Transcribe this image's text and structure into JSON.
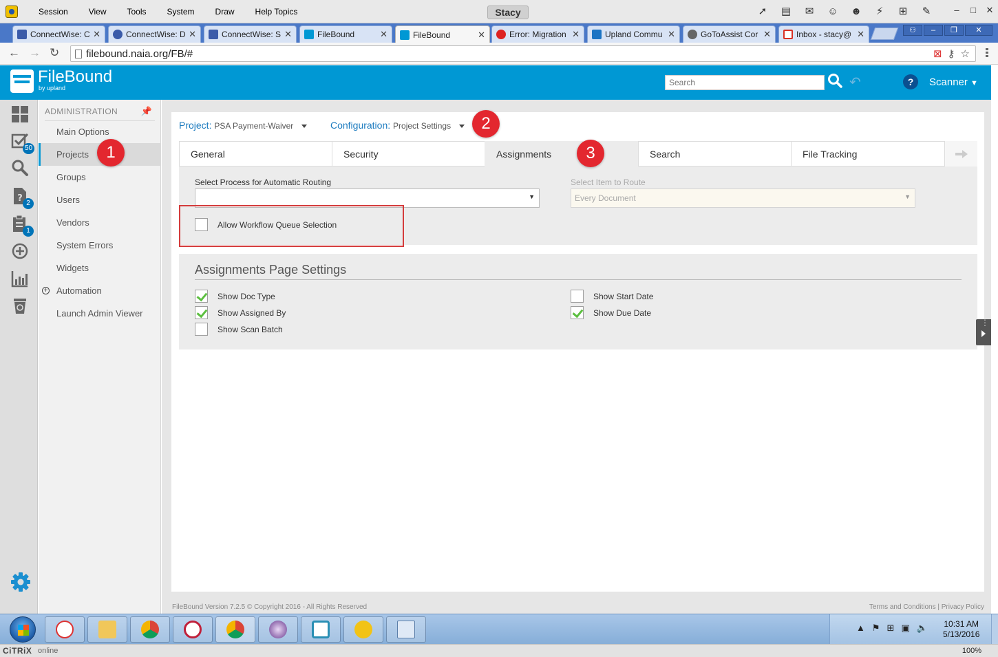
{
  "session": {
    "menu": [
      "Session",
      "View",
      "Tools",
      "System",
      "Draw",
      "Help Topics"
    ],
    "title": "Stacy",
    "tool_icons": [
      "cursor-icon",
      "clipboard-icon",
      "chat-icon",
      "users-icon",
      "user-icon",
      "plug-icon",
      "add-icon",
      "tools-icon"
    ]
  },
  "browser": {
    "tabs": [
      {
        "label": "ConnectWise: C",
        "icon": "connectwise-icon",
        "color": "#3b5ba9",
        "active": false
      },
      {
        "label": "ConnectWise: D",
        "icon": "connectwise-icon",
        "color": "#3b5ba9",
        "active": false
      },
      {
        "label": "ConnectWise: S",
        "icon": "connectwise-icon",
        "color": "#3b5ba9",
        "active": false
      },
      {
        "label": "FileBound",
        "icon": "filebound-icon",
        "color": "#0098d4",
        "active": false
      },
      {
        "label": "FileBound",
        "icon": "filebound-icon",
        "color": "#0098d4",
        "active": true
      },
      {
        "label": "Error: Migration",
        "icon": "error-icon",
        "color": "#d22",
        "active": false
      },
      {
        "label": "Upland Commu",
        "icon": "upland-icon",
        "color": "#1b74c4",
        "active": false
      },
      {
        "label": "GoToAssist Cor",
        "icon": "gotoassist-icon",
        "color": "#666",
        "active": false
      },
      {
        "label": "Inbox - stacy@",
        "icon": "gmail-icon",
        "color": "#d93025",
        "active": false
      }
    ],
    "url": "filebound.naia.org/FB/#"
  },
  "header": {
    "brand": "FileBound",
    "brand_sub": "by upland",
    "search_placeholder": "Search",
    "help": "?",
    "user_menu": "Scanner"
  },
  "rail": {
    "badges": {
      "tasks": "50",
      "help": "2",
      "clipboard": "1"
    }
  },
  "sidebar": {
    "heading": "ADMINISTRATION",
    "items": [
      {
        "label": "Main Options",
        "active": false
      },
      {
        "label": "Projects",
        "active": true
      },
      {
        "label": "Groups",
        "active": false
      },
      {
        "label": "Users",
        "active": false
      },
      {
        "label": "Vendors",
        "active": false
      },
      {
        "label": "System Errors",
        "active": false
      },
      {
        "label": "Widgets",
        "active": false
      },
      {
        "label": "Automation",
        "active": false
      },
      {
        "label": "Launch Admin Viewer",
        "active": false
      }
    ]
  },
  "project": {
    "project_label": "Project:",
    "project_value": "PSA Payment-Waiver",
    "config_label": "Configuration:",
    "config_value": "Project Settings"
  },
  "tabs": [
    "General",
    "Security",
    "Assignments",
    "Search",
    "File Tracking"
  ],
  "active_tab": "Assignments",
  "assignments": {
    "process_label": "Select Process for Automatic Routing",
    "process_value": "",
    "item_label": "Select Item to Route",
    "item_value": "Every Document",
    "allow_queue_label": "Allow Workflow Queue Selection",
    "allow_queue_checked": false
  },
  "page_settings": {
    "title": "Assignments Page Settings",
    "options": [
      {
        "label": "Show Doc Type",
        "checked": true
      },
      {
        "label": "Show Assigned By",
        "checked": true
      },
      {
        "label": "Show Scan Batch",
        "checked": false
      },
      {
        "label": "Show Start Date",
        "checked": false
      },
      {
        "label": "Show Due Date",
        "checked": true
      }
    ]
  },
  "annotations": [
    "1",
    "2",
    "3"
  ],
  "footer": {
    "version": "FileBound Version 7.2.5 © Copyright 2016 - All Rights Reserved",
    "terms": "Terms and Conditions",
    "separator": "|",
    "privacy": "Privacy Policy"
  },
  "taskbar": {
    "time": "10:31 AM",
    "date": "5/13/2016"
  },
  "citrix": {
    "logo": "CiTRiX",
    "status": "online",
    "zoom": "100%"
  }
}
